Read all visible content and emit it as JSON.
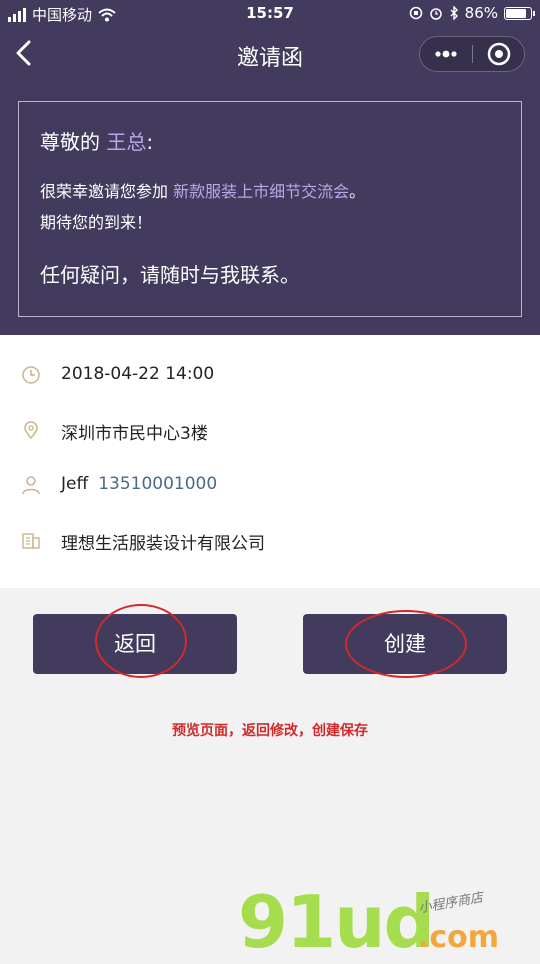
{
  "status_bar": {
    "carrier": "中国移动",
    "time": "15:57",
    "battery_percent": "86%",
    "battery_level": 0.86
  },
  "nav": {
    "title": "邀请函"
  },
  "card": {
    "greeting_prefix": "尊敬的",
    "guest_name": "王总",
    "greeting_suffix": ":",
    "invite_prefix": "很荣幸邀请您参加",
    "event_name": "新款服装上市细节交流会",
    "invite_suffix": "。",
    "expect_line": "期待您的到来！",
    "contact_line": "任何疑问，请随时与我联系。"
  },
  "info": {
    "datetime": "2018-04-22 14:00",
    "location": "深圳市市民中心3楼",
    "contact_name": "Jeff",
    "contact_phone": "13510001000",
    "company": "理想生活服装设计有限公司"
  },
  "buttons": {
    "back_label": "返回",
    "create_label": "创建"
  },
  "annotation": "预览页面，返回修改，创建保存",
  "watermark": {
    "main": "91ud",
    "com": ".com",
    "tag": "小程序商店"
  },
  "colors": {
    "brand": "#433b5e",
    "accent": "#b9a7e6",
    "annotation_red": "#d22a2a"
  },
  "icons": [
    "signal-icon",
    "wifi-icon",
    "back-icon",
    "more-icon",
    "close-icon",
    "clock-icon",
    "location-icon",
    "user-icon",
    "building-icon"
  ]
}
